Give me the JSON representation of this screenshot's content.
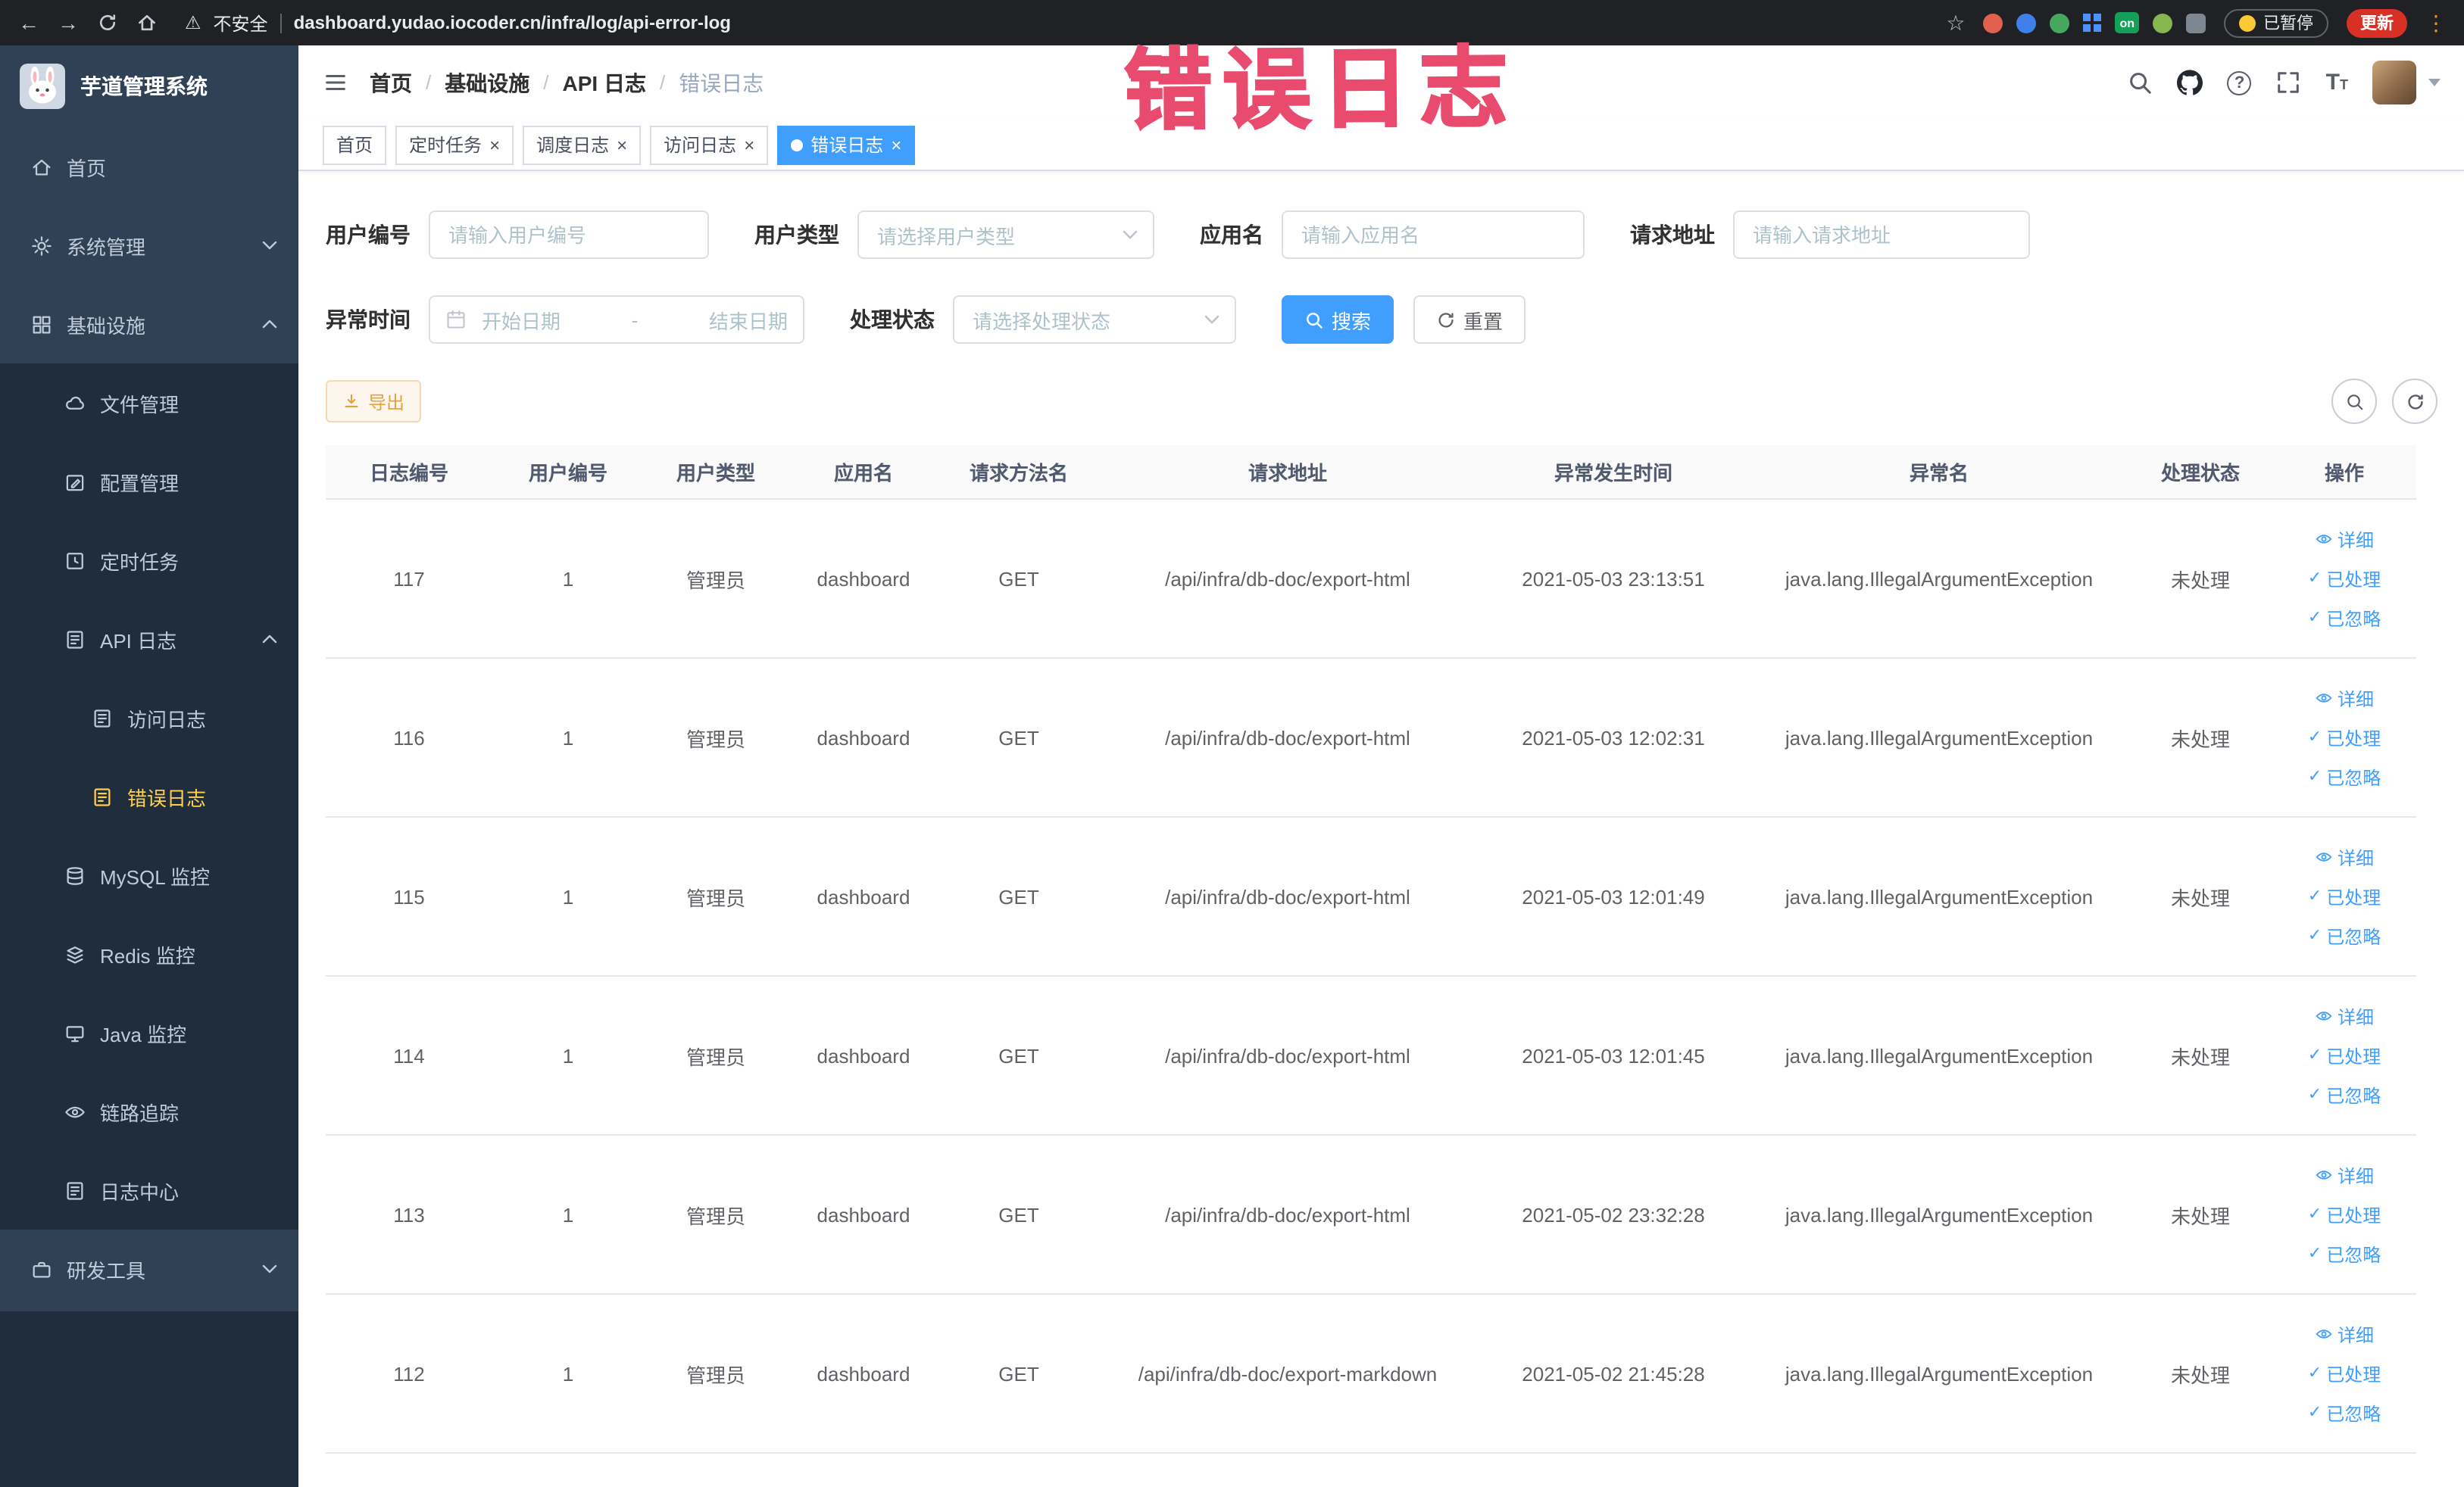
{
  "colors": {
    "primary": "#409eff",
    "sidebar_bg": "#304156",
    "sidebar_submenu_bg": "#1f2d3d",
    "sidebar_active_text": "#ffd04b",
    "warning_button": "#e6a23c",
    "tab_active_bg": "#409eff",
    "annotation_red": "#e94b6e",
    "update_button_bg": "#d93025"
  },
  "browser": {
    "security_label": "不安全",
    "url": "dashboard.yudao.iocoder.cn/infra/log/api-error-log",
    "on_badge": "on",
    "paused_label": "已暂停",
    "update_label": "更新"
  },
  "annotation": {
    "text": "错误日志"
  },
  "sidebar": {
    "logo_title": "芋道管理系统",
    "items": [
      {
        "label": "首页"
      },
      {
        "label": "系统管理"
      },
      {
        "label": "基础设施"
      },
      {
        "label": "文件管理"
      },
      {
        "label": "配置管理"
      },
      {
        "label": "定时任务"
      },
      {
        "label": "API 日志"
      },
      {
        "label": "访问日志"
      },
      {
        "label": "错误日志"
      },
      {
        "label": "MySQL 监控"
      },
      {
        "label": "Redis 监控"
      },
      {
        "label": "Java 监控"
      },
      {
        "label": "链路追踪"
      },
      {
        "label": "日志中心"
      },
      {
        "label": "研发工具"
      }
    ]
  },
  "header": {
    "breadcrumb": [
      {
        "label": "首页"
      },
      {
        "label": "基础设施"
      },
      {
        "label": "API 日志"
      },
      {
        "label": "错误日志"
      }
    ]
  },
  "tabs": [
    {
      "label": "首页",
      "closable": false,
      "active": false
    },
    {
      "label": "定时任务",
      "closable": true,
      "active": false
    },
    {
      "label": "调度日志",
      "closable": true,
      "active": false
    },
    {
      "label": "访问日志",
      "closable": true,
      "active": false
    },
    {
      "label": "错误日志",
      "closable": true,
      "active": true
    }
  ],
  "filters": {
    "user_id": {
      "label": "用户编号",
      "placeholder": "请输入用户编号",
      "value": ""
    },
    "user_type": {
      "label": "用户类型",
      "placeholder": "请选择用户类型",
      "value": ""
    },
    "app_name": {
      "label": "应用名",
      "placeholder": "请输入应用名",
      "value": ""
    },
    "request_url": {
      "label": "请求地址",
      "placeholder": "请输入请求地址",
      "value": ""
    },
    "exception_time": {
      "label": "异常时间",
      "start_placeholder": "开始日期",
      "separator": "-",
      "end_placeholder": "结束日期"
    },
    "process_status": {
      "label": "处理状态",
      "placeholder": "请选择处理状态",
      "value": ""
    },
    "search_label": "搜索",
    "reset_label": "重置"
  },
  "toolbar": {
    "export_label": "导出"
  },
  "table": {
    "columns": [
      "日志编号",
      "用户编号",
      "用户类型",
      "应用名",
      "请求方法名",
      "请求地址",
      "异常发生时间",
      "异常名",
      "处理状态",
      "操作"
    ],
    "actions": {
      "detail": "详细",
      "processed": "已处理",
      "ignored": "已忽略"
    },
    "rows": [
      {
        "log_id": "117",
        "user_id": "1",
        "user_type": "管理员",
        "app_name": "dashboard",
        "method": "GET",
        "url": "/api/infra/db-doc/export-html",
        "time": "2021-05-03 23:13:51",
        "exception": "java.lang.IllegalArgumentException",
        "status": "未处理"
      },
      {
        "log_id": "116",
        "user_id": "1",
        "user_type": "管理员",
        "app_name": "dashboard",
        "method": "GET",
        "url": "/api/infra/db-doc/export-html",
        "time": "2021-05-03 12:02:31",
        "exception": "java.lang.IllegalArgumentException",
        "status": "未处理"
      },
      {
        "log_id": "115",
        "user_id": "1",
        "user_type": "管理员",
        "app_name": "dashboard",
        "method": "GET",
        "url": "/api/infra/db-doc/export-html",
        "time": "2021-05-03 12:01:49",
        "exception": "java.lang.IllegalArgumentException",
        "status": "未处理"
      },
      {
        "log_id": "114",
        "user_id": "1",
        "user_type": "管理员",
        "app_name": "dashboard",
        "method": "GET",
        "url": "/api/infra/db-doc/export-html",
        "time": "2021-05-03 12:01:45",
        "exception": "java.lang.IllegalArgumentException",
        "status": "未处理"
      },
      {
        "log_id": "113",
        "user_id": "1",
        "user_type": "管理员",
        "app_name": "dashboard",
        "method": "GET",
        "url": "/api/infra/db-doc/export-html",
        "time": "2021-05-02 23:32:28",
        "exception": "java.lang.IllegalArgumentException",
        "status": "未处理"
      },
      {
        "log_id": "112",
        "user_id": "1",
        "user_type": "管理员",
        "app_name": "dashboard",
        "method": "GET",
        "url": "/api/infra/db-doc/export-markdown",
        "time": "2021-05-02 21:45:28",
        "exception": "java.lang.IllegalArgumentException",
        "status": "未处理"
      }
    ]
  }
}
